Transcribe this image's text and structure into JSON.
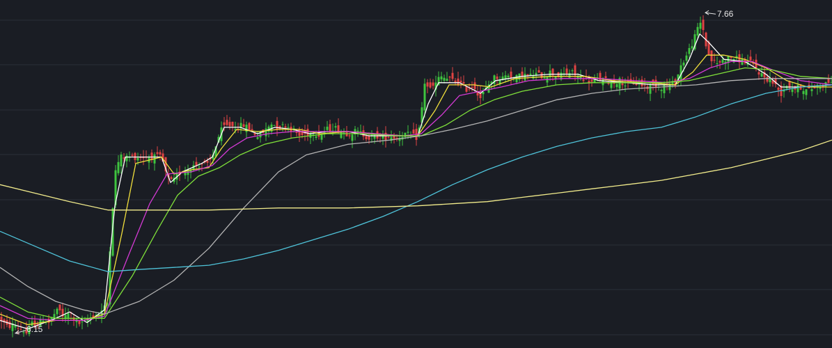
{
  "chart_data": {
    "type": "candlestick",
    "title": "",
    "xlabel": "",
    "ylabel": "",
    "ylim": [
      6.1,
      7.7
    ],
    "grid": true,
    "annotations": {
      "high": {
        "value": 7.66,
        "label": "7.66"
      },
      "low": {
        "value": 6.15,
        "label": "6.15"
      }
    },
    "colors": {
      "background": "#1a1d24",
      "grid": "#2a2e39",
      "up": "#3fc43f",
      "down": "#e04343",
      "ma5": "#ffffff",
      "ma10": "#f2e03c",
      "ma20": "#d43ad4",
      "ma30": "#7fe03a",
      "ma60": "#b4b4b4",
      "ma120": "#4fc3d9",
      "ma250": "#f2ec8c"
    },
    "close_path": [
      [
        0,
        6.22
      ],
      [
        10,
        6.18
      ],
      [
        20,
        6.19
      ],
      [
        30,
        6.17
      ],
      [
        38,
        6.15
      ],
      [
        47,
        6.2
      ],
      [
        55,
        6.19
      ],
      [
        62,
        6.22
      ],
      [
        70,
        6.2
      ],
      [
        78,
        6.24
      ],
      [
        85,
        6.26
      ],
      [
        92,
        6.22
      ],
      [
        100,
        6.25
      ],
      [
        108,
        6.21
      ],
      [
        116,
        6.19
      ],
      [
        124,
        6.21
      ],
      [
        132,
        6.23
      ],
      [
        140,
        6.24
      ],
      [
        148,
        6.26
      ],
      [
        155,
        6.3
      ],
      [
        158,
        6.55
      ],
      [
        165,
        6.9
      ],
      [
        172,
        6.98
      ],
      [
        186,
        6.98
      ],
      [
        232,
        6.98
      ],
      [
        240,
        6.88
      ],
      [
        248,
        6.86
      ],
      [
        256,
        6.9
      ],
      [
        264,
        6.92
      ],
      [
        272,
        6.93
      ],
      [
        280,
        6.94
      ],
      [
        290,
        6.95
      ],
      [
        298,
        6.94
      ],
      [
        305,
        6.98
      ],
      [
        312,
        7.06
      ],
      [
        320,
        7.12
      ],
      [
        330,
        7.13
      ],
      [
        340,
        7.12
      ],
      [
        350,
        7.13
      ],
      [
        360,
        7.11
      ],
      [
        370,
        7.08
      ],
      [
        380,
        7.1
      ],
      [
        390,
        7.14
      ],
      [
        400,
        7.12
      ],
      [
        410,
        7.13
      ],
      [
        420,
        7.11
      ],
      [
        430,
        7.08
      ],
      [
        440,
        7.09
      ],
      [
        450,
        7.1
      ],
      [
        460,
        7.08
      ],
      [
        470,
        7.11
      ],
      [
        480,
        7.12
      ],
      [
        490,
        7.1
      ],
      [
        500,
        7.09
      ],
      [
        510,
        7.1
      ],
      [
        520,
        7.09
      ],
      [
        530,
        7.07
      ],
      [
        540,
        7.08
      ],
      [
        550,
        7.07
      ],
      [
        560,
        7.08
      ],
      [
        570,
        7.07
      ],
      [
        580,
        7.09
      ],
      [
        590,
        7.08
      ],
      [
        600,
        7.07
      ],
      [
        605,
        7.18
      ],
      [
        610,
        7.33
      ],
      [
        618,
        7.3
      ],
      [
        625,
        7.32
      ],
      [
        632,
        7.36
      ],
      [
        640,
        7.35
      ],
      [
        650,
        7.34
      ],
      [
        660,
        7.33
      ],
      [
        670,
        7.3
      ],
      [
        680,
        7.32
      ],
      [
        690,
        7.26
      ],
      [
        698,
        7.3
      ],
      [
        705,
        7.34
      ],
      [
        712,
        7.36
      ],
      [
        720,
        7.35
      ],
      [
        730,
        7.37
      ],
      [
        740,
        7.35
      ],
      [
        750,
        7.37
      ],
      [
        760,
        7.36
      ],
      [
        770,
        7.37
      ],
      [
        780,
        7.36
      ],
      [
        790,
        7.38
      ],
      [
        800,
        7.36
      ],
      [
        810,
        7.37
      ],
      [
        820,
        7.38
      ],
      [
        830,
        7.36
      ],
      [
        840,
        7.35
      ],
      [
        850,
        7.33
      ],
      [
        860,
        7.35
      ],
      [
        870,
        7.34
      ],
      [
        880,
        7.33
      ],
      [
        890,
        7.34
      ],
      [
        900,
        7.32
      ],
      [
        910,
        7.33
      ],
      [
        920,
        7.32
      ],
      [
        930,
        7.31
      ],
      [
        940,
        7.32
      ],
      [
        950,
        7.31
      ],
      [
        960,
        7.32
      ],
      [
        970,
        7.33
      ],
      [
        978,
        7.41
      ],
      [
        985,
        7.45
      ],
      [
        992,
        7.5
      ],
      [
        1000,
        7.56
      ],
      [
        1005,
        7.62
      ],
      [
        1010,
        7.58
      ],
      [
        1015,
        7.49
      ],
      [
        1020,
        7.44
      ],
      [
        1030,
        7.42
      ],
      [
        1040,
        7.44
      ],
      [
        1050,
        7.45
      ],
      [
        1060,
        7.44
      ],
      [
        1070,
        7.43
      ],
      [
        1080,
        7.42
      ],
      [
        1090,
        7.38
      ],
      [
        1100,
        7.35
      ],
      [
        1108,
        7.34
      ],
      [
        1115,
        7.31
      ],
      [
        1122,
        7.28
      ],
      [
        1130,
        7.32
      ],
      [
        1140,
        7.3
      ],
      [
        1150,
        7.31
      ],
      [
        1160,
        7.29
      ],
      [
        1170,
        7.31
      ],
      [
        1180,
        7.32
      ],
      [
        1195,
        7.34
      ]
    ],
    "moving_averages": [
      {
        "key": "ma5",
        "values": [
          [
            0,
            6.21
          ],
          [
            40,
            6.17
          ],
          [
            80,
            6.22
          ],
          [
            100,
            6.25
          ],
          [
            125,
            6.2
          ],
          [
            150,
            6.26
          ],
          [
            165,
            6.75
          ],
          [
            180,
            6.98
          ],
          [
            232,
            6.98
          ],
          [
            245,
            6.86
          ],
          [
            262,
            6.91
          ],
          [
            290,
            6.95
          ],
          [
            305,
            6.98
          ],
          [
            322,
            7.12
          ],
          [
            345,
            7.12
          ],
          [
            370,
            7.09
          ],
          [
            395,
            7.12
          ],
          [
            420,
            7.11
          ],
          [
            445,
            7.09
          ],
          [
            470,
            7.1
          ],
          [
            500,
            7.1
          ],
          [
            530,
            7.08
          ],
          [
            560,
            7.08
          ],
          [
            600,
            7.08
          ],
          [
            615,
            7.23
          ],
          [
            630,
            7.33
          ],
          [
            660,
            7.33
          ],
          [
            690,
            7.28
          ],
          [
            712,
            7.34
          ],
          [
            750,
            7.36
          ],
          [
            790,
            7.37
          ],
          [
            830,
            7.37
          ],
          [
            860,
            7.34
          ],
          [
            900,
            7.33
          ],
          [
            940,
            7.32
          ],
          [
            970,
            7.32
          ],
          [
            990,
            7.44
          ],
          [
            1005,
            7.56
          ],
          [
            1018,
            7.52
          ],
          [
            1040,
            7.44
          ],
          [
            1070,
            7.43
          ],
          [
            1100,
            7.37
          ],
          [
            1122,
            7.31
          ],
          [
            1150,
            7.31
          ],
          [
            1195,
            7.32
          ]
        ]
      },
      {
        "key": "ma10",
        "values": [
          [
            0,
            6.24
          ],
          [
            40,
            6.19
          ],
          [
            80,
            6.21
          ],
          [
            120,
            6.21
          ],
          [
            150,
            6.24
          ],
          [
            175,
            6.62
          ],
          [
            195,
            6.95
          ],
          [
            232,
            6.98
          ],
          [
            250,
            6.9
          ],
          [
            275,
            6.92
          ],
          [
            300,
            6.93
          ],
          [
            318,
            7.02
          ],
          [
            340,
            7.11
          ],
          [
            370,
            7.1
          ],
          [
            400,
            7.11
          ],
          [
            430,
            7.11
          ],
          [
            460,
            7.09
          ],
          [
            500,
            7.1
          ],
          [
            540,
            7.09
          ],
          [
            580,
            7.08
          ],
          [
            600,
            7.08
          ],
          [
            625,
            7.2
          ],
          [
            645,
            7.32
          ],
          [
            680,
            7.32
          ],
          [
            705,
            7.31
          ],
          [
            740,
            7.35
          ],
          [
            790,
            7.36
          ],
          [
            840,
            7.36
          ],
          [
            880,
            7.34
          ],
          [
            930,
            7.33
          ],
          [
            970,
            7.32
          ],
          [
            995,
            7.38
          ],
          [
            1015,
            7.46
          ],
          [
            1040,
            7.46
          ],
          [
            1070,
            7.44
          ],
          [
            1100,
            7.4
          ],
          [
            1130,
            7.34
          ],
          [
            1160,
            7.31
          ],
          [
            1195,
            7.31
          ]
        ]
      },
      {
        "key": "ma20",
        "values": [
          [
            0,
            6.28
          ],
          [
            40,
            6.22
          ],
          [
            80,
            6.21
          ],
          [
            120,
            6.21
          ],
          [
            150,
            6.23
          ],
          [
            185,
            6.52
          ],
          [
            215,
            6.76
          ],
          [
            240,
            6.9
          ],
          [
            275,
            6.91
          ],
          [
            305,
            6.94
          ],
          [
            330,
            7.02
          ],
          [
            355,
            7.07
          ],
          [
            385,
            7.09
          ],
          [
            420,
            7.1
          ],
          [
            460,
            7.1
          ],
          [
            500,
            7.1
          ],
          [
            540,
            7.09
          ],
          [
            580,
            7.08
          ],
          [
            605,
            7.09
          ],
          [
            635,
            7.18
          ],
          [
            660,
            7.27
          ],
          [
            690,
            7.29
          ],
          [
            720,
            7.31
          ],
          [
            760,
            7.34
          ],
          [
            810,
            7.35
          ],
          [
            860,
            7.35
          ],
          [
            910,
            7.34
          ],
          [
            960,
            7.33
          ],
          [
            990,
            7.35
          ],
          [
            1020,
            7.4
          ],
          [
            1050,
            7.43
          ],
          [
            1080,
            7.43
          ],
          [
            1110,
            7.39
          ],
          [
            1150,
            7.34
          ],
          [
            1195,
            7.32
          ]
        ]
      },
      {
        "key": "ma30",
        "values": [
          [
            0,
            6.32
          ],
          [
            40,
            6.25
          ],
          [
            80,
            6.22
          ],
          [
            120,
            6.22
          ],
          [
            150,
            6.22
          ],
          [
            190,
            6.42
          ],
          [
            225,
            6.63
          ],
          [
            255,
            6.8
          ],
          [
            285,
            6.89
          ],
          [
            315,
            6.93
          ],
          [
            345,
            6.99
          ],
          [
            380,
            7.04
          ],
          [
            420,
            7.07
          ],
          [
            470,
            7.09
          ],
          [
            520,
            7.09
          ],
          [
            570,
            7.08
          ],
          [
            605,
            7.08
          ],
          [
            640,
            7.13
          ],
          [
            675,
            7.2
          ],
          [
            710,
            7.25
          ],
          [
            750,
            7.29
          ],
          [
            800,
            7.32
          ],
          [
            850,
            7.33
          ],
          [
            900,
            7.33
          ],
          [
            950,
            7.33
          ],
          [
            990,
            7.34
          ],
          [
            1030,
            7.37
          ],
          [
            1070,
            7.4
          ],
          [
            1110,
            7.39
          ],
          [
            1150,
            7.36
          ],
          [
            1195,
            7.35
          ]
        ]
      },
      {
        "key": "ma60",
        "values": [
          [
            0,
            6.46
          ],
          [
            40,
            6.37
          ],
          [
            80,
            6.3
          ],
          [
            120,
            6.26
          ],
          [
            150,
            6.24
          ],
          [
            200,
            6.3
          ],
          [
            250,
            6.4
          ],
          [
            300,
            6.55
          ],
          [
            350,
            6.74
          ],
          [
            400,
            6.91
          ],
          [
            440,
            6.99
          ],
          [
            500,
            7.04
          ],
          [
            560,
            7.06
          ],
          [
            605,
            7.08
          ],
          [
            650,
            7.11
          ],
          [
            700,
            7.15
          ],
          [
            750,
            7.2
          ],
          [
            800,
            7.25
          ],
          [
            850,
            7.28
          ],
          [
            900,
            7.3
          ],
          [
            950,
            7.31
          ],
          [
            1000,
            7.32
          ],
          [
            1050,
            7.34
          ],
          [
            1100,
            7.35
          ],
          [
            1150,
            7.35
          ],
          [
            1195,
            7.35
          ]
        ]
      },
      {
        "key": "ma120",
        "values": [
          [
            0,
            6.63
          ],
          [
            50,
            6.56
          ],
          [
            100,
            6.49
          ],
          [
            155,
            6.44
          ],
          [
            200,
            6.45
          ],
          [
            250,
            6.46
          ],
          [
            300,
            6.47
          ],
          [
            350,
            6.5
          ],
          [
            400,
            6.54
          ],
          [
            450,
            6.59
          ],
          [
            500,
            6.64
          ],
          [
            550,
            6.7
          ],
          [
            600,
            6.77
          ],
          [
            650,
            6.85
          ],
          [
            700,
            6.92
          ],
          [
            750,
            6.98
          ],
          [
            800,
            7.03
          ],
          [
            850,
            7.07
          ],
          [
            900,
            7.1
          ],
          [
            950,
            7.12
          ],
          [
            1000,
            7.17
          ],
          [
            1050,
            7.23
          ],
          [
            1100,
            7.28
          ],
          [
            1150,
            7.31
          ],
          [
            1195,
            7.32
          ]
        ]
      },
      {
        "key": "ma250",
        "values": [
          [
            0,
            6.85
          ],
          [
            50,
            6.81
          ],
          [
            100,
            6.77
          ],
          [
            155,
            6.73
          ],
          [
            200,
            6.73
          ],
          [
            300,
            6.73
          ],
          [
            400,
            6.74
          ],
          [
            500,
            6.74
          ],
          [
            600,
            6.75
          ],
          [
            650,
            6.76
          ],
          [
            700,
            6.77
          ],
          [
            750,
            6.79
          ],
          [
            800,
            6.81
          ],
          [
            850,
            6.83
          ],
          [
            900,
            6.85
          ],
          [
            950,
            6.87
          ],
          [
            1000,
            6.9
          ],
          [
            1050,
            6.93
          ],
          [
            1100,
            6.97
          ],
          [
            1150,
            7.01
          ],
          [
            1195,
            7.06
          ]
        ]
      }
    ]
  }
}
